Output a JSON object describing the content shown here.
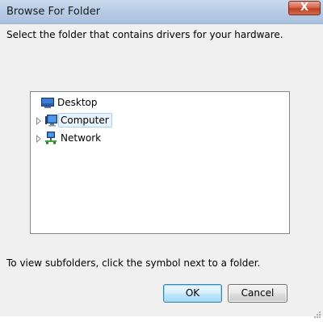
{
  "window": {
    "title": "Browse For Folder",
    "close_label": "X"
  },
  "instruction": "Select the folder that contains drivers for your hardware.",
  "tree": {
    "items": [
      {
        "label": "Desktop",
        "icon": "desktop-icon",
        "expandable": false,
        "selected": false
      },
      {
        "label": "Computer",
        "icon": "computer-icon",
        "expandable": true,
        "selected": true
      },
      {
        "label": "Network",
        "icon": "network-icon",
        "expandable": true,
        "selected": false
      }
    ]
  },
  "hint": "To view subfolders, click the symbol next to a folder.",
  "buttons": {
    "ok_label": "OK",
    "cancel_label": "Cancel"
  },
  "colors": {
    "selection_fill": "#e8f3fd",
    "selection_border": "#a8d2f8",
    "close_button": "#c1401f",
    "default_button_border": "#3c7fb1"
  }
}
